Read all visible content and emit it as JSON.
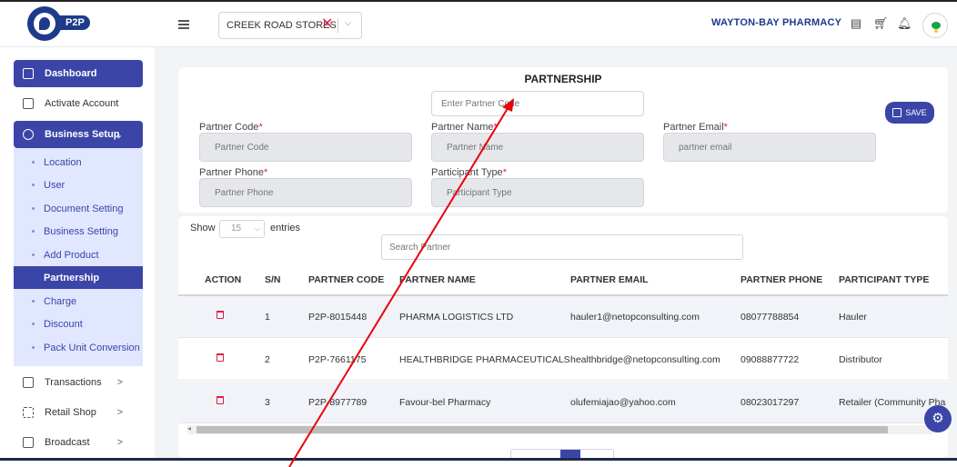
{
  "header": {
    "logo_text": "P2P",
    "store": "CREEK ROAD STORES",
    "pharmacy": "WAYTON-BAY PHARMACY"
  },
  "sidebar": {
    "items": [
      {
        "label": "Dashboard",
        "icon": "grid-icon",
        "active": true
      },
      {
        "label": "Activate Account",
        "icon": "card-icon"
      },
      {
        "label": "Business Setup",
        "icon": "gear-icon",
        "active": true,
        "chevron": "⌄"
      },
      {
        "label": "Transactions",
        "icon": "copy-icon",
        "chevron": ">"
      },
      {
        "label": "Retail Shop",
        "icon": "shop-icon",
        "chevron": ">"
      },
      {
        "label": "Broadcast",
        "icon": "folder-icon",
        "chevron": ">"
      }
    ],
    "sub_items": [
      {
        "label": "Location"
      },
      {
        "label": "User"
      },
      {
        "label": "Document Setting"
      },
      {
        "label": "Business Setting"
      },
      {
        "label": "Add Product"
      },
      {
        "label": "Partnership",
        "active": true
      },
      {
        "label": "Charge"
      },
      {
        "label": "Discount"
      },
      {
        "label": "Pack Unit Conversion"
      }
    ]
  },
  "form": {
    "title": "PARTNERSHIP",
    "code_placeholder": "Enter Partner Code",
    "save_label": "SAVE",
    "fields": {
      "partner_code": {
        "label": "Partner Code",
        "placeholder": "Partner Code"
      },
      "partner_name": {
        "label": "Partner Name",
        "placeholder": "Partner Name"
      },
      "partner_email": {
        "label": "Partner Email",
        "placeholder": "partner email"
      },
      "partner_phone": {
        "label": "Partner Phone",
        "placeholder": "Partner Phone"
      },
      "participant_type": {
        "label": "Participant Type",
        "placeholder": "Participant Type"
      }
    },
    "required_mark": "*"
  },
  "table": {
    "show_label": "Show",
    "entries_value": "15",
    "entries_label": "entries",
    "search_placeholder": "Search Partner",
    "columns": [
      "ACTION",
      "S/N",
      "PARTNER CODE",
      "PARTNER NAME",
      "PARTNER EMAIL",
      "PARTNER PHONE",
      "PARTICIPANT TYPE"
    ],
    "rows": [
      {
        "sn": "1",
        "code": "P2P-8015448",
        "name": "PHARMA LOGISTICS LTD",
        "email": "hauler1@netopconsulting.com",
        "phone": "08077788854",
        "type": "Hauler"
      },
      {
        "sn": "2",
        "code": "P2P-7661175",
        "name": "HEALTHBRIDGE PHARMACEUTICALS",
        "email": "healthbridge@netopconsulting.com",
        "phone": "09088877722",
        "type": "Distributor"
      },
      {
        "sn": "3",
        "code": "P2P-8977789",
        "name": "Favour-bel Pharmacy",
        "email": "olufemiajao@yahoo.com",
        "phone": "08023017297",
        "type": "Retailer (Community Pha"
      }
    ]
  },
  "colors": {
    "primary": "#3b45a8",
    "danger": "#e11d48",
    "annotation": "#e8000b"
  }
}
